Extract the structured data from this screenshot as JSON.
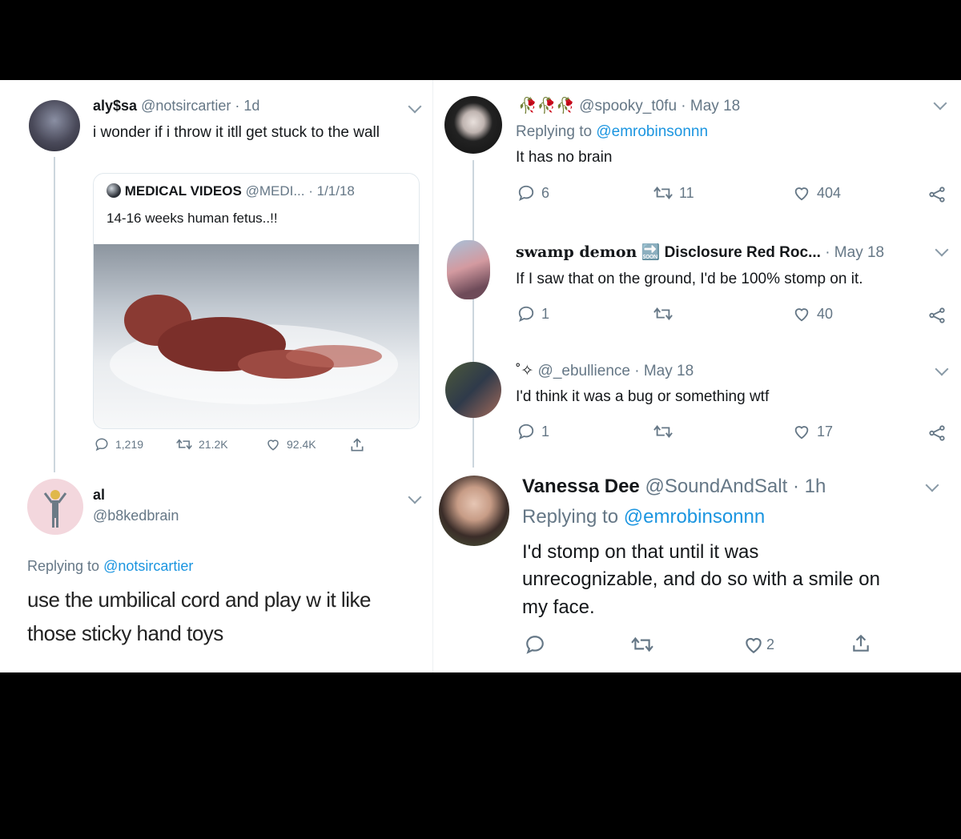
{
  "left": {
    "tweet1": {
      "name": "aly$sa",
      "handle": "@notsircartier",
      "time": "· 1d",
      "text": "i wonder if i throw it itll get stuck to the wall",
      "quoted": {
        "name": "MEDICAL VIDEOS",
        "handle": "@MEDI...",
        "time": "· 1/1/18",
        "text": "14-16 weeks human fetus..!!",
        "image_icon": "photo-placeholder-icon",
        "actions": {
          "replies": "1,219",
          "retweets": "21.2K",
          "likes": "92.4K"
        }
      }
    },
    "tweet2": {
      "name": "al",
      "handle": "@b8kedbrain",
      "replying_prefix": "Replying to ",
      "replying_to": "@notsircartier",
      "text_line1": "use the umbilical cord and play w it like",
      "text_line2": "those sticky hand toys"
    }
  },
  "right": {
    "tweet1": {
      "emoji": "🥀🥀🥀",
      "handle": "@spooky_t0fu",
      "time": "· May 18",
      "replying_prefix": "Replying to ",
      "replying_to": "@emrobinsonnn",
      "text": "It has no brain",
      "replies": "6",
      "retweets": "11",
      "likes": "404"
    },
    "tweet2": {
      "name": "swamp demon",
      "name_emoji": "🔜",
      "name_suffix": "Disclosure Red Roc...",
      "time": "· May 18",
      "text": "If I saw that on the ground, I'd be 100% stomp on it.",
      "replies": "1",
      "likes": "40"
    },
    "tweet3": {
      "emoji": "˚✧",
      "handle": "@_ebullience",
      "time": "· May 18",
      "text": "I'd think it was a bug or something wtf",
      "replies": "1",
      "likes": "17"
    },
    "tweet4": {
      "name": "Vanessa Dee",
      "handle": "@SoundAndSalt",
      "time": "· 1h",
      "replying_prefix": "Replying to ",
      "replying_to": "@emrobinsonnn",
      "text_line1": "I'd stomp on that until it was",
      "text_line2": "unrecognizable, and do so with a smile on",
      "text_line3": "my face.",
      "likes": "2"
    }
  },
  "colors": {
    "background": "#000000",
    "panel": "#ffffff",
    "text": "#14171a",
    "muted": "#657786",
    "link": "#1b95e0",
    "divider": "#ccd6dd"
  }
}
